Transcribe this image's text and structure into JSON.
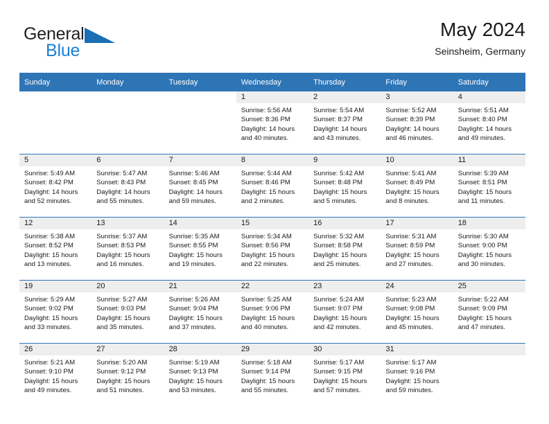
{
  "brand": {
    "name_top": "General",
    "name_bottom": "Blue",
    "triangle_icon": "blue-triangle-icon",
    "colors": {
      "text_dark": "#231f20",
      "blue": "#1a7fd4"
    }
  },
  "header": {
    "title": "May 2024",
    "subtitle": "Seinsheim, Germany"
  },
  "theme": {
    "header_band": "#2e75b6",
    "day_strip": "#eeeeee",
    "cell_background": "#ffffff",
    "row_divider": "#2e75b6"
  },
  "calendar": {
    "weekday_headers": [
      "Sunday",
      "Monday",
      "Tuesday",
      "Wednesday",
      "Thursday",
      "Friday",
      "Saturday"
    ],
    "labels": {
      "sunrise": "Sunrise:",
      "sunset": "Sunset:",
      "daylight": "Daylight:"
    },
    "weeks": [
      [
        {
          "blank": true
        },
        {
          "blank": true
        },
        {
          "blank": true
        },
        {
          "day": "1",
          "sunrise": "Sunrise: 5:56 AM",
          "sunset": "Sunset: 8:36 PM",
          "daylight_l1": "Daylight: 14 hours",
          "daylight_l2": "and 40 minutes."
        },
        {
          "day": "2",
          "sunrise": "Sunrise: 5:54 AM",
          "sunset": "Sunset: 8:37 PM",
          "daylight_l1": "Daylight: 14 hours",
          "daylight_l2": "and 43 minutes."
        },
        {
          "day": "3",
          "sunrise": "Sunrise: 5:52 AM",
          "sunset": "Sunset: 8:39 PM",
          "daylight_l1": "Daylight: 14 hours",
          "daylight_l2": "and 46 minutes."
        },
        {
          "day": "4",
          "sunrise": "Sunrise: 5:51 AM",
          "sunset": "Sunset: 8:40 PM",
          "daylight_l1": "Daylight: 14 hours",
          "daylight_l2": "and 49 minutes."
        }
      ],
      [
        {
          "day": "5",
          "sunrise": "Sunrise: 5:49 AM",
          "sunset": "Sunset: 8:42 PM",
          "daylight_l1": "Daylight: 14 hours",
          "daylight_l2": "and 52 minutes."
        },
        {
          "day": "6",
          "sunrise": "Sunrise: 5:47 AM",
          "sunset": "Sunset: 8:43 PM",
          "daylight_l1": "Daylight: 14 hours",
          "daylight_l2": "and 55 minutes."
        },
        {
          "day": "7",
          "sunrise": "Sunrise: 5:46 AM",
          "sunset": "Sunset: 8:45 PM",
          "daylight_l1": "Daylight: 14 hours",
          "daylight_l2": "and 59 minutes."
        },
        {
          "day": "8",
          "sunrise": "Sunrise: 5:44 AM",
          "sunset": "Sunset: 8:46 PM",
          "daylight_l1": "Daylight: 15 hours",
          "daylight_l2": "and 2 minutes."
        },
        {
          "day": "9",
          "sunrise": "Sunrise: 5:42 AM",
          "sunset": "Sunset: 8:48 PM",
          "daylight_l1": "Daylight: 15 hours",
          "daylight_l2": "and 5 minutes."
        },
        {
          "day": "10",
          "sunrise": "Sunrise: 5:41 AM",
          "sunset": "Sunset: 8:49 PM",
          "daylight_l1": "Daylight: 15 hours",
          "daylight_l2": "and 8 minutes."
        },
        {
          "day": "11",
          "sunrise": "Sunrise: 5:39 AM",
          "sunset": "Sunset: 8:51 PM",
          "daylight_l1": "Daylight: 15 hours",
          "daylight_l2": "and 11 minutes."
        }
      ],
      [
        {
          "day": "12",
          "sunrise": "Sunrise: 5:38 AM",
          "sunset": "Sunset: 8:52 PM",
          "daylight_l1": "Daylight: 15 hours",
          "daylight_l2": "and 13 minutes."
        },
        {
          "day": "13",
          "sunrise": "Sunrise: 5:37 AM",
          "sunset": "Sunset: 8:53 PM",
          "daylight_l1": "Daylight: 15 hours",
          "daylight_l2": "and 16 minutes."
        },
        {
          "day": "14",
          "sunrise": "Sunrise: 5:35 AM",
          "sunset": "Sunset: 8:55 PM",
          "daylight_l1": "Daylight: 15 hours",
          "daylight_l2": "and 19 minutes."
        },
        {
          "day": "15",
          "sunrise": "Sunrise: 5:34 AM",
          "sunset": "Sunset: 8:56 PM",
          "daylight_l1": "Daylight: 15 hours",
          "daylight_l2": "and 22 minutes."
        },
        {
          "day": "16",
          "sunrise": "Sunrise: 5:32 AM",
          "sunset": "Sunset: 8:58 PM",
          "daylight_l1": "Daylight: 15 hours",
          "daylight_l2": "and 25 minutes."
        },
        {
          "day": "17",
          "sunrise": "Sunrise: 5:31 AM",
          "sunset": "Sunset: 8:59 PM",
          "daylight_l1": "Daylight: 15 hours",
          "daylight_l2": "and 27 minutes."
        },
        {
          "day": "18",
          "sunrise": "Sunrise: 5:30 AM",
          "sunset": "Sunset: 9:00 PM",
          "daylight_l1": "Daylight: 15 hours",
          "daylight_l2": "and 30 minutes."
        }
      ],
      [
        {
          "day": "19",
          "sunrise": "Sunrise: 5:29 AM",
          "sunset": "Sunset: 9:02 PM",
          "daylight_l1": "Daylight: 15 hours",
          "daylight_l2": "and 33 minutes."
        },
        {
          "day": "20",
          "sunrise": "Sunrise: 5:27 AM",
          "sunset": "Sunset: 9:03 PM",
          "daylight_l1": "Daylight: 15 hours",
          "daylight_l2": "and 35 minutes."
        },
        {
          "day": "21",
          "sunrise": "Sunrise: 5:26 AM",
          "sunset": "Sunset: 9:04 PM",
          "daylight_l1": "Daylight: 15 hours",
          "daylight_l2": "and 37 minutes."
        },
        {
          "day": "22",
          "sunrise": "Sunrise: 5:25 AM",
          "sunset": "Sunset: 9:06 PM",
          "daylight_l1": "Daylight: 15 hours",
          "daylight_l2": "and 40 minutes."
        },
        {
          "day": "23",
          "sunrise": "Sunrise: 5:24 AM",
          "sunset": "Sunset: 9:07 PM",
          "daylight_l1": "Daylight: 15 hours",
          "daylight_l2": "and 42 minutes."
        },
        {
          "day": "24",
          "sunrise": "Sunrise: 5:23 AM",
          "sunset": "Sunset: 9:08 PM",
          "daylight_l1": "Daylight: 15 hours",
          "daylight_l2": "and 45 minutes."
        },
        {
          "day": "25",
          "sunrise": "Sunrise: 5:22 AM",
          "sunset": "Sunset: 9:09 PM",
          "daylight_l1": "Daylight: 15 hours",
          "daylight_l2": "and 47 minutes."
        }
      ],
      [
        {
          "day": "26",
          "sunrise": "Sunrise: 5:21 AM",
          "sunset": "Sunset: 9:10 PM",
          "daylight_l1": "Daylight: 15 hours",
          "daylight_l2": "and 49 minutes."
        },
        {
          "day": "27",
          "sunrise": "Sunrise: 5:20 AM",
          "sunset": "Sunset: 9:12 PM",
          "daylight_l1": "Daylight: 15 hours",
          "daylight_l2": "and 51 minutes."
        },
        {
          "day": "28",
          "sunrise": "Sunrise: 5:19 AM",
          "sunset": "Sunset: 9:13 PM",
          "daylight_l1": "Daylight: 15 hours",
          "daylight_l2": "and 53 minutes."
        },
        {
          "day": "29",
          "sunrise": "Sunrise: 5:18 AM",
          "sunset": "Sunset: 9:14 PM",
          "daylight_l1": "Daylight: 15 hours",
          "daylight_l2": "and 55 minutes."
        },
        {
          "day": "30",
          "sunrise": "Sunrise: 5:17 AM",
          "sunset": "Sunset: 9:15 PM",
          "daylight_l1": "Daylight: 15 hours",
          "daylight_l2": "and 57 minutes."
        },
        {
          "day": "31",
          "sunrise": "Sunrise: 5:17 AM",
          "sunset": "Sunset: 9:16 PM",
          "daylight_l1": "Daylight: 15 hours",
          "daylight_l2": "and 59 minutes."
        },
        {
          "day": "",
          "empty": true
        }
      ]
    ]
  }
}
